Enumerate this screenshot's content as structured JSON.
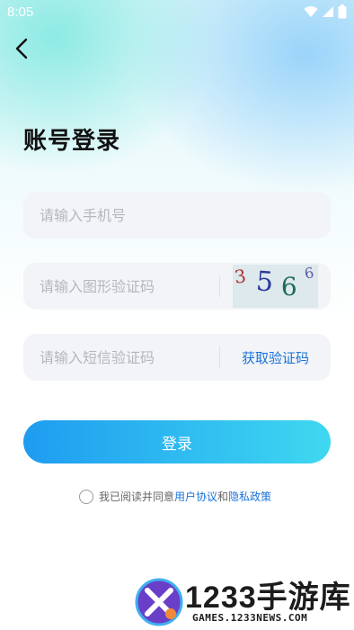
{
  "status_bar": {
    "time": "8:05"
  },
  "title": "账号登录",
  "fields": {
    "phone_placeholder": "请输入手机号",
    "captcha_placeholder": "请输入图形验证码",
    "sms_placeholder": "请输入短信验证码"
  },
  "captcha_chars": [
    "3",
    "5",
    "6",
    "6"
  ],
  "sms_button": "获取验证码",
  "login_button": "登录",
  "agreement": {
    "prefix": "我已阅读并同意",
    "user_agreement": "用户协议",
    "and": "和",
    "privacy_policy": "隐私政策"
  },
  "watermark": {
    "brand": "1233手游库",
    "site": "GAMES.1233NEWS.COM"
  },
  "colors": {
    "accent": "#1a73d8",
    "button_start": "#1e9cf0",
    "button_end": "#3fd8f0",
    "field_bg": "#f2f4f7"
  }
}
